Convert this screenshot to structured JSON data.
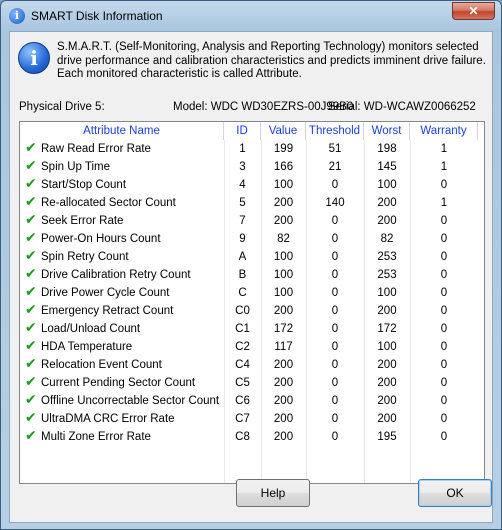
{
  "window": {
    "title": "SMART Disk Information",
    "close_glyph": "✕"
  },
  "info": {
    "icon_glyph": "i",
    "text": "S.M.A.R.T. (Self-Monitoring, Analysis and Reporting Technology) monitors selected drive performance and calibration characteristics and predicts imminent drive failure. Each monitored characteristic is called Attribute."
  },
  "drive": {
    "label": "Physical Drive 5:",
    "model": "Model: WDC WD30EZRS-00J99B0",
    "serial": "Serial: WD-WCAWZ0066252"
  },
  "table": {
    "columns": [
      "Attribute Name",
      "ID",
      "Value",
      "Threshold",
      "Worst",
      "Warranty"
    ],
    "rows": [
      [
        "Raw Read Error Rate",
        "1",
        "199",
        "51",
        "198",
        "1"
      ],
      [
        "Spin Up Time",
        "3",
        "166",
        "21",
        "145",
        "1"
      ],
      [
        "Start/Stop Count",
        "4",
        "100",
        "0",
        "100",
        "0"
      ],
      [
        "Re-allocated Sector Count",
        "5",
        "200",
        "140",
        "200",
        "1"
      ],
      [
        "Seek Error Rate",
        "7",
        "200",
        "0",
        "200",
        "0"
      ],
      [
        "Power-On Hours Count",
        "9",
        "82",
        "0",
        "82",
        "0"
      ],
      [
        "Spin Retry Count",
        "A",
        "100",
        "0",
        "253",
        "0"
      ],
      [
        "Drive Calibration Retry Count",
        "B",
        "100",
        "0",
        "253",
        "0"
      ],
      [
        "Drive Power Cycle Count",
        "C",
        "100",
        "0",
        "100",
        "0"
      ],
      [
        "Emergency Retract Count",
        "C0",
        "200",
        "0",
        "200",
        "0"
      ],
      [
        "Load/Unload Count",
        "C1",
        "172",
        "0",
        "172",
        "0"
      ],
      [
        "HDA Temperature",
        "C2",
        "117",
        "0",
        "100",
        "0"
      ],
      [
        "Relocation Event Count",
        "C4",
        "200",
        "0",
        "200",
        "0"
      ],
      [
        "Current Pending Sector Count",
        "C5",
        "200",
        "0",
        "200",
        "0"
      ],
      [
        "Offline Uncorrectable Sector Count",
        "C6",
        "200",
        "0",
        "200",
        "0"
      ],
      [
        "UltraDMA CRC Error Rate",
        "C7",
        "200",
        "0",
        "200",
        "0"
      ],
      [
        "Multi Zone Error Rate",
        "C8",
        "200",
        "0",
        "195",
        "0"
      ]
    ],
    "check_glyph": "✔"
  },
  "buttons": {
    "help": "Help",
    "ok": "OK"
  }
}
